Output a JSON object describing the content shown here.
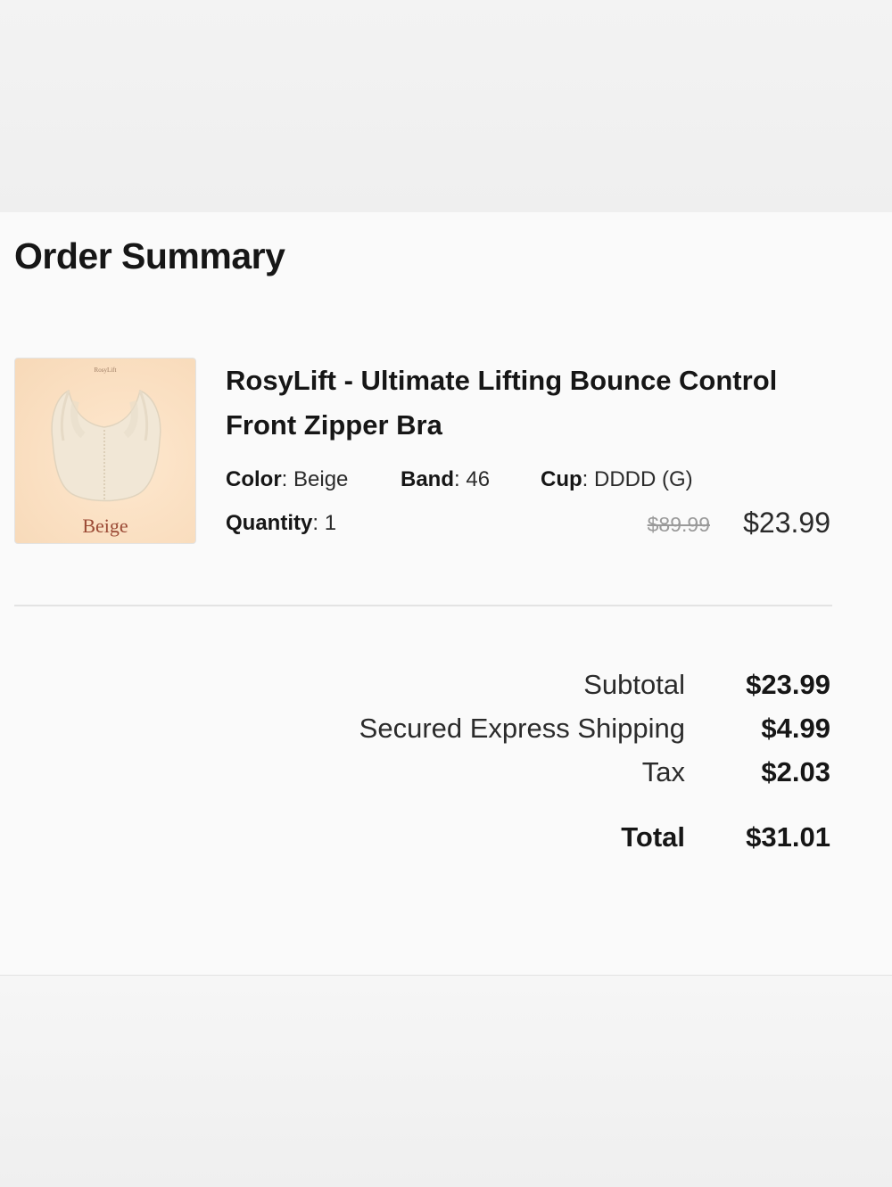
{
  "order": {
    "title": "Order Summary"
  },
  "item": {
    "image": {
      "brand_text": "RosyLift",
      "color_label": "Beige"
    },
    "name": "RosyLift - Ultimate Lifting Bounce Control Front Zipper Bra",
    "attributes": {
      "color_label": "Color",
      "color_value": "Beige",
      "band_label": "Band",
      "band_value": "46",
      "cup_label": "Cup",
      "cup_value": "DDDD (G)",
      "quantity_label": "Quantity",
      "quantity_value": "1"
    },
    "original_price": "$89.99",
    "price": "$23.99"
  },
  "summary": {
    "subtotal_label": "Subtotal",
    "subtotal_value": "$23.99",
    "shipping_label": "Secured Express Shipping",
    "shipping_value": "$4.99",
    "tax_label": "Tax",
    "tax_value": "$2.03",
    "total_label": "Total",
    "total_value": "$31.01"
  },
  "colors": {
    "page_bg": "#f6f6f6",
    "panel_bg": "#fafafa",
    "text": "#161616",
    "strike_price": "#9a9a9a",
    "divider": "#e3e3e3"
  }
}
